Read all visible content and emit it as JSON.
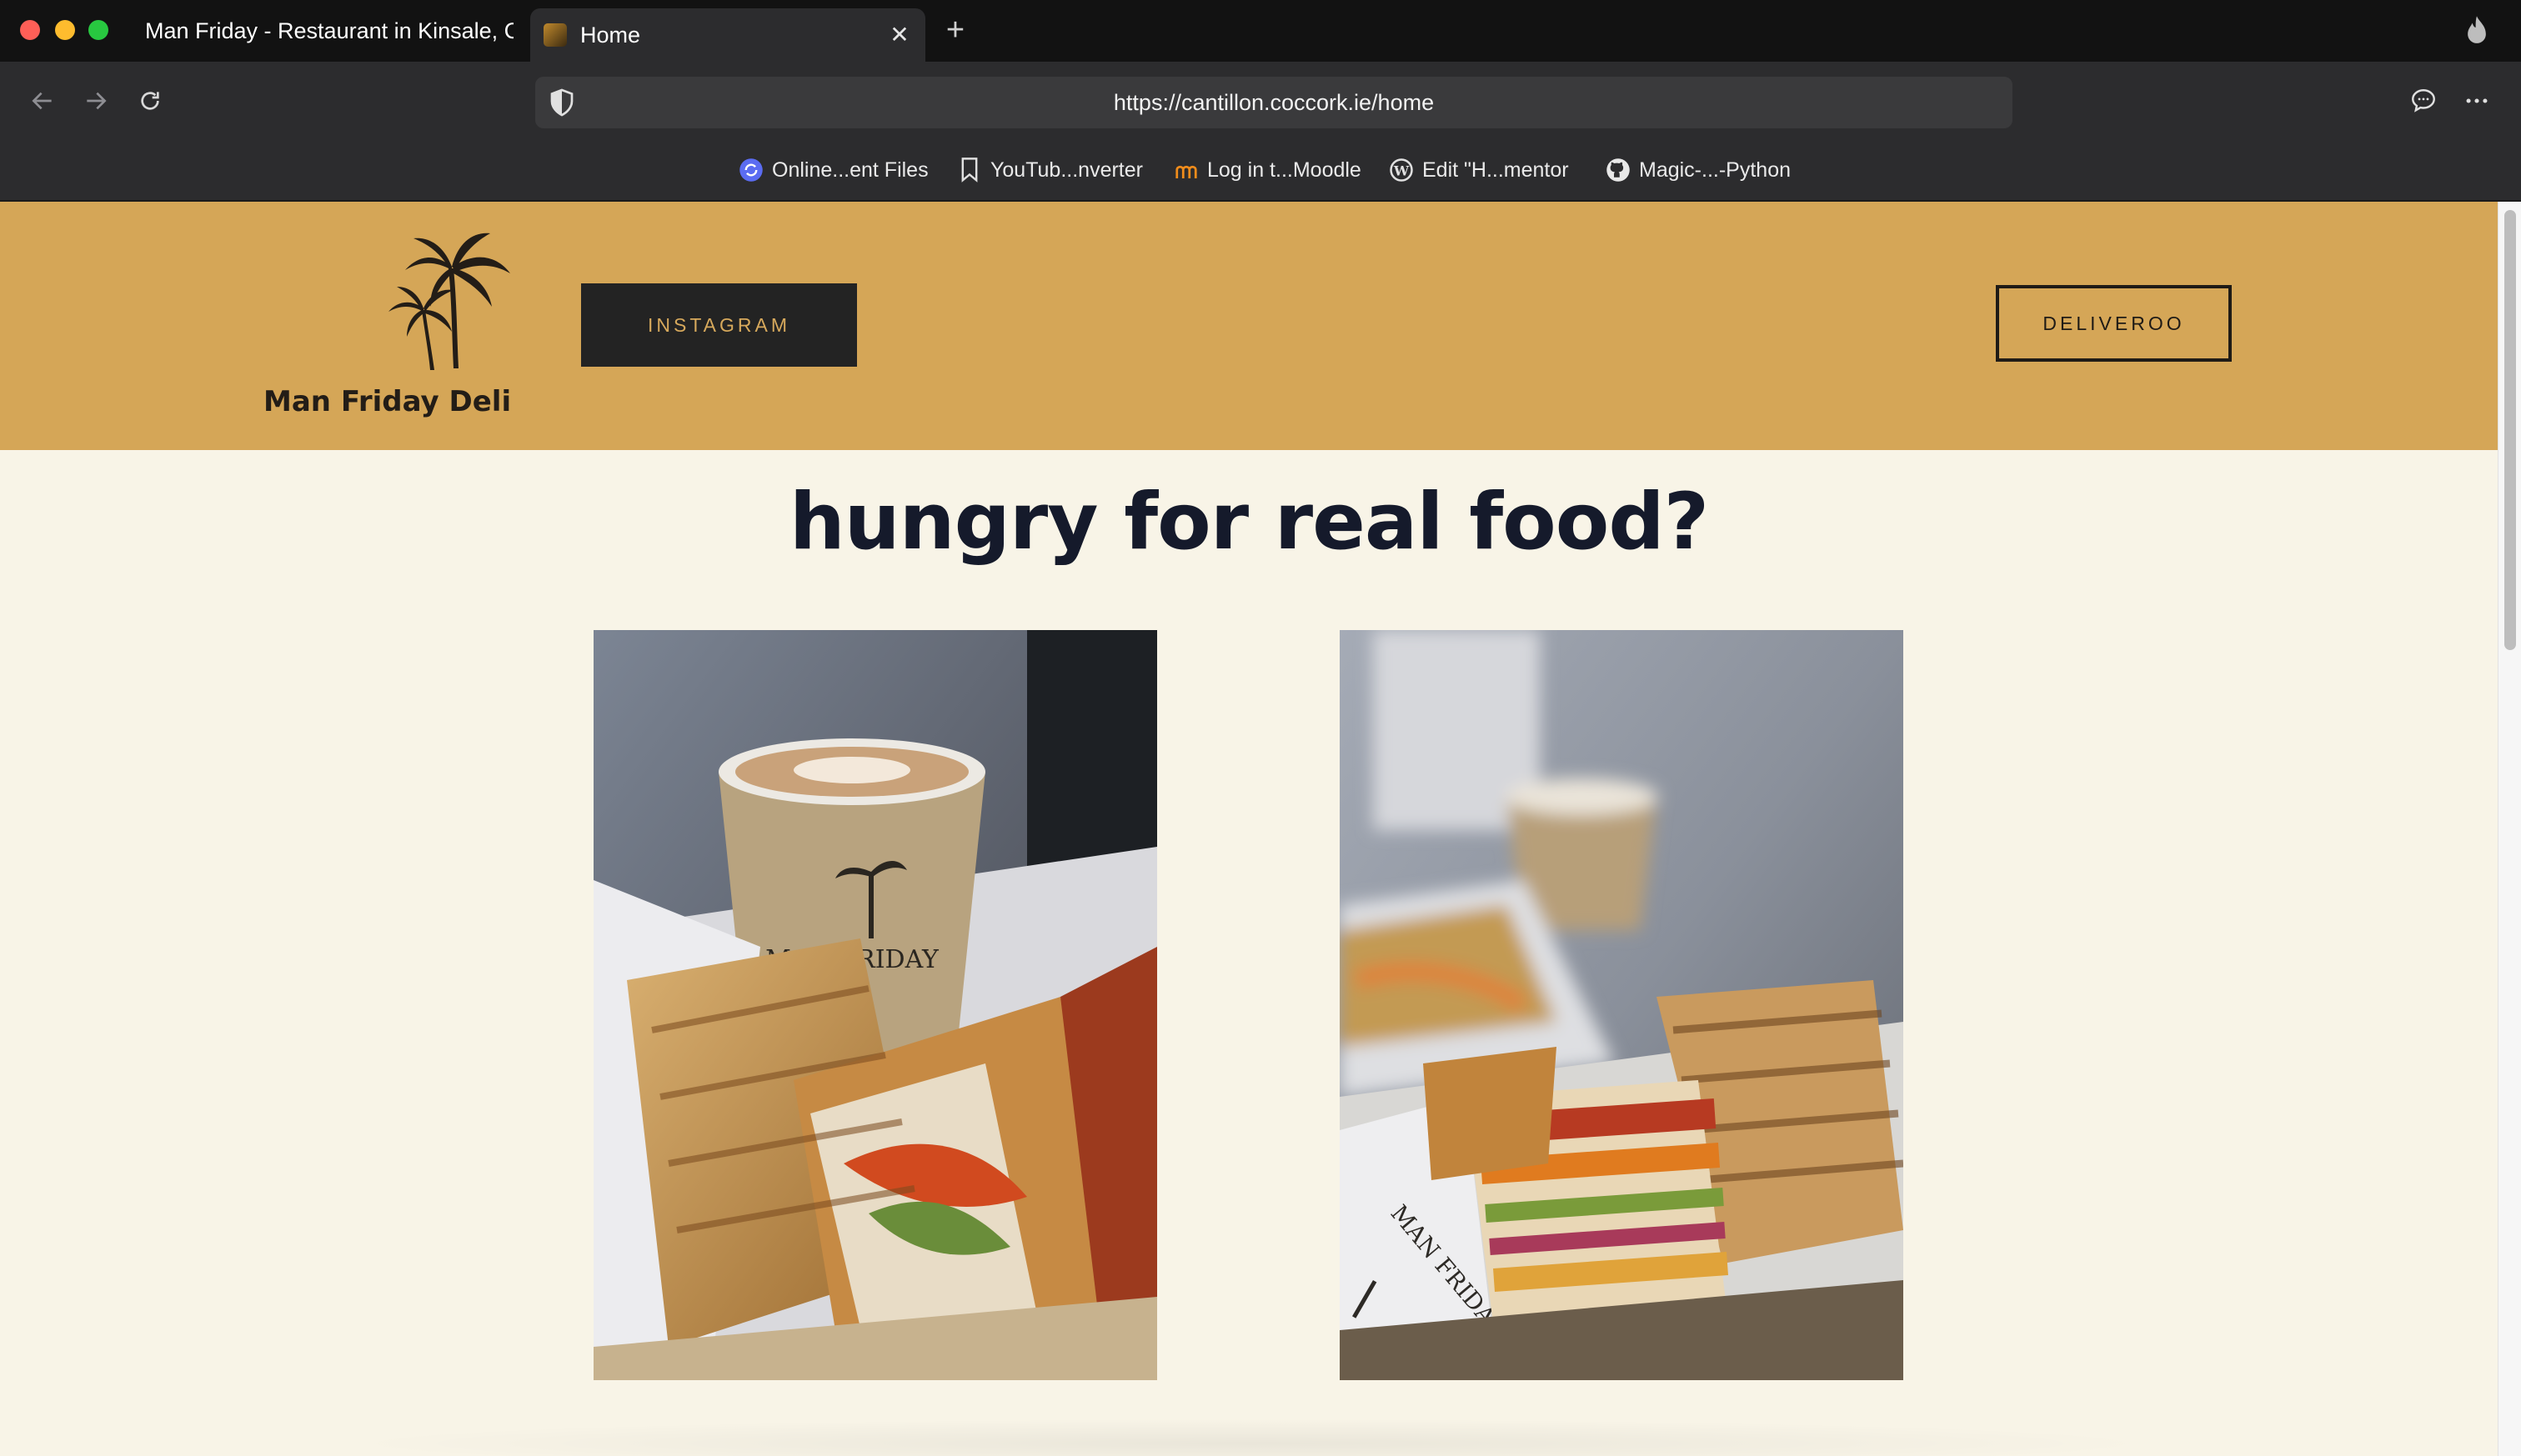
{
  "browser": {
    "tabs": [
      {
        "title": "Man Friday - Restaurant in Kinsale, C",
        "active": false
      },
      {
        "title": "Home",
        "active": true
      }
    ],
    "url": "https://cantillon.coccork.ie/home",
    "bookmarks": [
      {
        "label": "Online...ent Files",
        "icon": "sync-icon"
      },
      {
        "label": "YouTub...nverter",
        "icon": "bookmark-icon"
      },
      {
        "label": "Log in t...Moodle",
        "icon": "moodle-icon"
      },
      {
        "label": "Edit \"H...mentor",
        "icon": "wordpress-icon"
      },
      {
        "label": "Magic-...-Python",
        "icon": "github-icon"
      }
    ],
    "colors": {
      "tabbar": "#121212",
      "toolbar": "#2c2c2e",
      "urlbar": "#3a3a3c"
    }
  },
  "site": {
    "logo_text": "Man Friday Deli",
    "instagram_label": "INSTAGRAM",
    "deliveroo_label": "DELIVEROO",
    "headline": "hungry for real food?",
    "photos": [
      {
        "subject": "toasted sandwich with Man Friday coffee cup"
      },
      {
        "subject": "club sandwich in Man Friday wrapper with coffee"
      }
    ],
    "colors": {
      "header": "#d5a657",
      "page": "#f8f4e7",
      "headline": "#151a2b",
      "button_dark": "#232323"
    }
  }
}
